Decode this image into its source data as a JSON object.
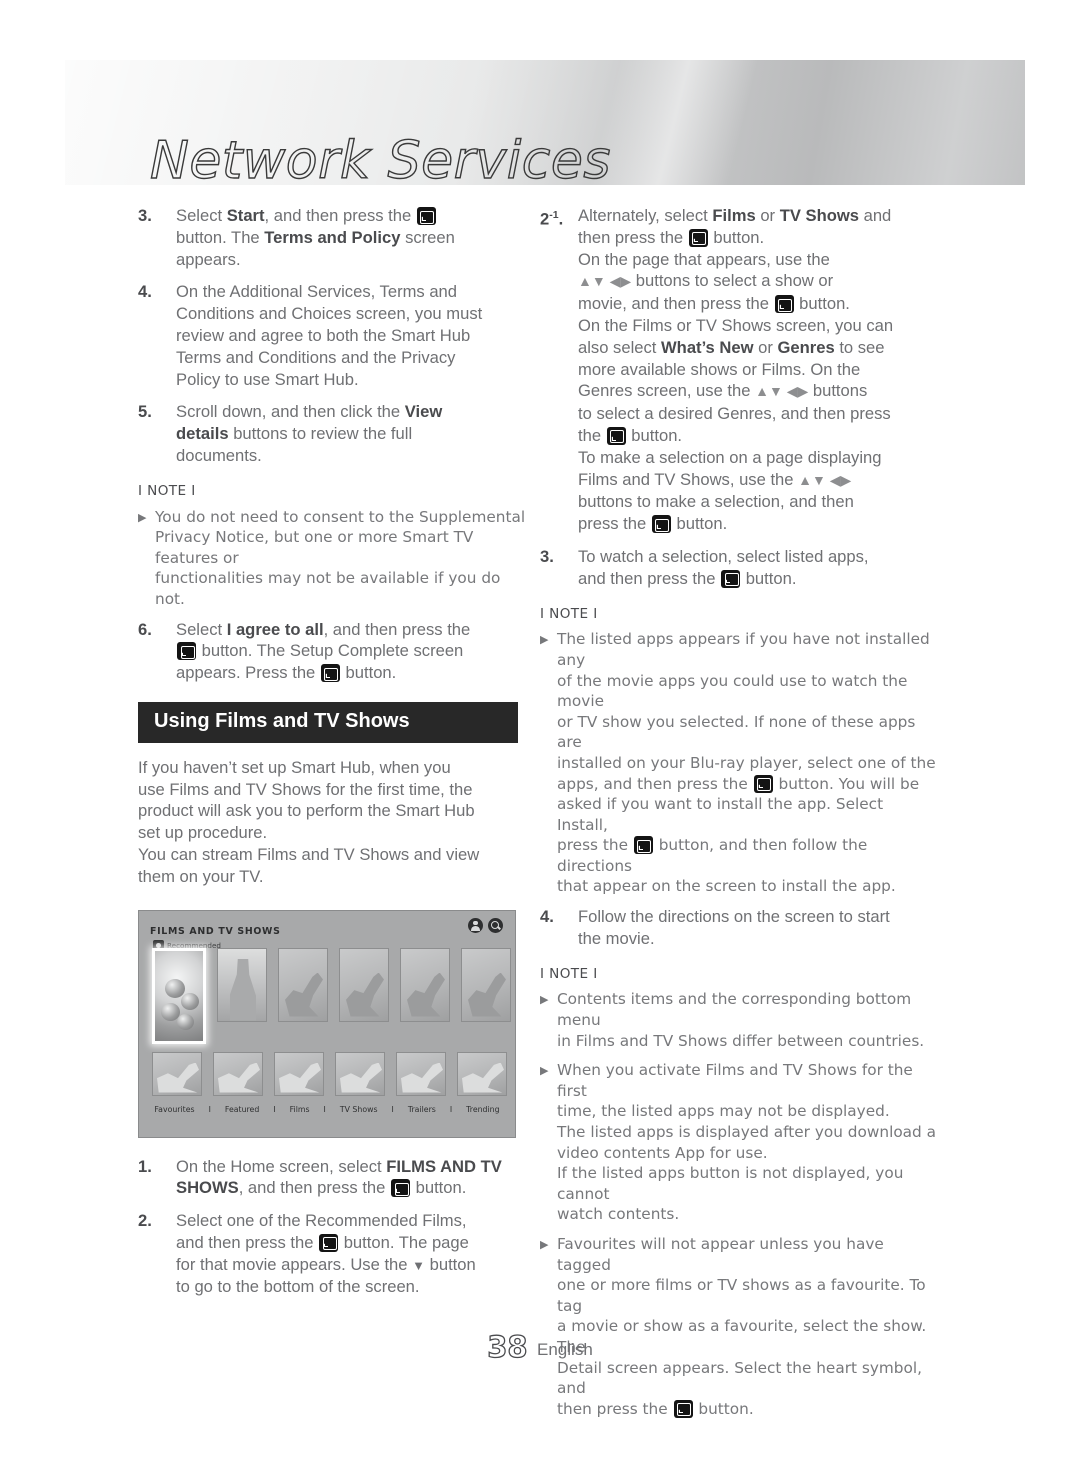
{
  "header": {
    "title": "Network Services"
  },
  "icons": {
    "enter_button": "enter-button-icon",
    "dpad_arrows": "▲▼ ◀▶",
    "down_arrow": "▼"
  },
  "left_column": {
    "steps": [
      {
        "num": "3.",
        "lines": [
          {
            "parts": [
              {
                "t": "Select "
              },
              {
                "t": "Start",
                "b": true
              },
              {
                "t": ", and then press the "
              },
              {
                "icon": "enter"
              }
            ]
          },
          {
            "parts": [
              {
                "t": "button. The "
              },
              {
                "t": "Terms and Policy",
                "b": true
              },
              {
                "t": " screen"
              }
            ]
          },
          {
            "parts": [
              {
                "t": "appears."
              }
            ]
          }
        ]
      },
      {
        "num": "4.",
        "lines": [
          {
            "parts": [
              {
                "t": "On the Additional Services, Terms and"
              }
            ]
          },
          {
            "parts": [
              {
                "t": "Conditions and Choices screen, you must"
              }
            ]
          },
          {
            "parts": [
              {
                "t": "review and agree to both the Smart Hub"
              }
            ]
          },
          {
            "parts": [
              {
                "t": "Terms and Conditions and the Privacy"
              }
            ]
          },
          {
            "parts": [
              {
                "t": "Policy to use Smart Hub."
              }
            ]
          }
        ]
      },
      {
        "num": "5.",
        "lines": [
          {
            "parts": [
              {
                "t": "Scroll down, and then click the "
              },
              {
                "t": "View",
                "b": true
              }
            ]
          },
          {
            "parts": [
              {
                "t": "details",
                "b": true
              },
              {
                "t": " buttons to review the full"
              }
            ]
          },
          {
            "parts": [
              {
                "t": "documents."
              }
            ]
          }
        ]
      }
    ],
    "note": {
      "head": "I NOTE I",
      "items": [
        {
          "lines": [
            {
              "parts": [
                {
                  "t": "You do not need to consent to the Supplemental"
                }
              ]
            },
            {
              "parts": [
                {
                  "t": "Privacy Notice, but one or more Smart TV features or"
                }
              ]
            },
            {
              "parts": [
                {
                  "t": "functionalities may not be available if you do not."
                }
              ]
            }
          ]
        }
      ]
    },
    "step6": {
      "num": "6.",
      "lines": [
        {
          "parts": [
            {
              "t": "Select "
            },
            {
              "t": "I agree to all",
              "b": true
            },
            {
              "t": ", and then press the"
            }
          ]
        },
        {
          "parts": [
            {
              "icon": "enter"
            },
            {
              "t": " button. The Setup Complete screen"
            }
          ]
        },
        {
          "parts": [
            {
              "t": "appears. Press the "
            },
            {
              "icon": "enter"
            },
            {
              "t": " button."
            }
          ]
        }
      ]
    },
    "section_title": "Using Films and TV Shows",
    "intro": [
      "If you haven’t set up Smart Hub, when you",
      "use Films and TV Shows for the first time, the",
      "product will ask you to perform the Smart Hub",
      "set up procedure.",
      "You can stream Films and TV Shows and view",
      "them on your TV."
    ],
    "tv_screenshot": {
      "title": "FILMS AND TV SHOWS",
      "account_icon": "person-icon",
      "search_icon": "search-icon",
      "recommended_label": "Recommended",
      "menu": [
        "Favourites",
        "Featured",
        "Films",
        "TV Shows",
        "Trailers",
        "Trending"
      ],
      "menu_separator": "I"
    },
    "steps_after": [
      {
        "num": "1.",
        "lines": [
          {
            "parts": [
              {
                "t": "On the Home screen, select "
              },
              {
                "t": "FILMS AND TV",
                "b": true
              }
            ]
          },
          {
            "parts": [
              {
                "t": "SHOWS",
                "b": true
              },
              {
                "t": ", and then press the "
              },
              {
                "icon": "enter"
              },
              {
                "t": " button."
              }
            ]
          }
        ]
      },
      {
        "num": "2.",
        "lines": [
          {
            "parts": [
              {
                "t": "Select one of the Recommended Films,"
              }
            ]
          },
          {
            "parts": [
              {
                "t": "and then press the "
              },
              {
                "icon": "enter"
              },
              {
                "t": " button. The page"
              }
            ]
          },
          {
            "parts": [
              {
                "t": "for that movie appears. Use the "
              },
              {
                "icon": "down"
              },
              {
                "t": " button"
              }
            ]
          },
          {
            "parts": [
              {
                "t": "to go to the bottom of the screen."
              }
            ]
          }
        ]
      }
    ]
  },
  "right_column": {
    "steps": [
      {
        "num": "2",
        "sup": "-1",
        "dot": ".",
        "lines": [
          {
            "parts": [
              {
                "t": "Alternately, select "
              },
              {
                "t": "Films",
                "b": true
              },
              {
                "t": " or "
              },
              {
                "t": "TV Shows",
                "b": true
              },
              {
                "t": " and"
              }
            ]
          },
          {
            "parts": [
              {
                "t": "then press the "
              },
              {
                "icon": "enter"
              },
              {
                "t": " button."
              }
            ]
          },
          {
            "parts": [
              {
                "t": "On the page that appears, use the"
              }
            ]
          },
          {
            "parts": [
              {
                "icon": "dpad"
              },
              {
                "t": " buttons to select a show or"
              }
            ]
          },
          {
            "parts": [
              {
                "t": "movie, and then press the "
              },
              {
                "icon": "enter"
              },
              {
                "t": " button."
              }
            ]
          },
          {
            "parts": [
              {
                "t": "On the Films or TV Shows screen, you can"
              }
            ]
          },
          {
            "parts": [
              {
                "t": "also select "
              },
              {
                "t": "What’s New",
                "b": true
              },
              {
                "t": " or "
              },
              {
                "t": "Genres",
                "b": true
              },
              {
                "t": " to see"
              }
            ]
          },
          {
            "parts": [
              {
                "t": "more available shows or Films. On the"
              }
            ]
          },
          {
            "parts": [
              {
                "t": "Genres screen, use the "
              },
              {
                "icon": "dpad"
              },
              {
                "t": " buttons"
              }
            ]
          },
          {
            "parts": [
              {
                "t": "to select a desired Genres, and then press"
              }
            ]
          },
          {
            "parts": [
              {
                "t": "the "
              },
              {
                "icon": "enter"
              },
              {
                "t": " button."
              }
            ]
          },
          {
            "parts": [
              {
                "t": "To make a selection on a page displaying"
              }
            ]
          },
          {
            "parts": [
              {
                "t": "Films and TV Shows, use the "
              },
              {
                "icon": "dpad"
              }
            ]
          },
          {
            "parts": [
              {
                "t": "buttons to make a selection, and then"
              }
            ]
          },
          {
            "parts": [
              {
                "t": "press the "
              },
              {
                "icon": "enter"
              },
              {
                "t": " button."
              }
            ]
          }
        ]
      },
      {
        "num": "3.",
        "lines": [
          {
            "parts": [
              {
                "t": "To watch a selection, select listed apps,"
              }
            ]
          },
          {
            "parts": [
              {
                "t": "and then press the "
              },
              {
                "icon": "enter"
              },
              {
                "t": " button."
              }
            ]
          }
        ]
      }
    ],
    "note1": {
      "head": "I NOTE I",
      "items": [
        {
          "lines": [
            {
              "parts": [
                {
                  "t": "The listed apps appears if you have not installed any"
                }
              ]
            },
            {
              "parts": [
                {
                  "t": "of the movie apps you could use to watch the movie"
                }
              ]
            },
            {
              "parts": [
                {
                  "t": "or TV show you selected. If none of these apps are"
                }
              ]
            },
            {
              "parts": [
                {
                  "t": "installed on your Blu-ray player, select one of the"
                }
              ]
            },
            {
              "parts": [
                {
                  "t": "apps, and then press the "
                },
                {
                  "icon": "enter"
                },
                {
                  "t": " button. You will be"
                }
              ]
            },
            {
              "parts": [
                {
                  "t": "asked if you want to install the app. Select Install,"
                }
              ]
            },
            {
              "parts": [
                {
                  "t": "press the "
                },
                {
                  "icon": "enter"
                },
                {
                  "t": " button, and then follow the directions"
                }
              ]
            },
            {
              "parts": [
                {
                  "t": "that appear on the screen to install the app."
                }
              ]
            }
          ]
        }
      ]
    },
    "step4": {
      "num": "4.",
      "lines": [
        {
          "parts": [
            {
              "t": "Follow the directions on the screen to start"
            }
          ]
        },
        {
          "parts": [
            {
              "t": "the movie."
            }
          ]
        }
      ]
    },
    "note2": {
      "head": "I NOTE I",
      "items": [
        {
          "lines": [
            {
              "parts": [
                {
                  "t": "Contents items and the corresponding bottom menu"
                }
              ]
            },
            {
              "parts": [
                {
                  "t": "in Films and TV Shows differ between countries."
                }
              ]
            }
          ]
        },
        {
          "lines": [
            {
              "parts": [
                {
                  "t": "When you activate Films and TV Shows for the first"
                }
              ]
            },
            {
              "parts": [
                {
                  "t": "time, the listed apps may not be displayed."
                }
              ]
            },
            {
              "parts": [
                {
                  "t": "The listed apps is displayed after you download a"
                }
              ]
            },
            {
              "parts": [
                {
                  "t": "video contents App for use."
                }
              ]
            },
            {
              "parts": [
                {
                  "t": "If the listed apps button is not displayed, you cannot"
                }
              ]
            },
            {
              "parts": [
                {
                  "t": "watch contents."
                }
              ]
            }
          ]
        },
        {
          "lines": [
            {
              "parts": [
                {
                  "t": "Favourites will not appear unless you have tagged"
                }
              ]
            },
            {
              "parts": [
                {
                  "t": "one or more  films or TV shows as a favourite. To tag"
                }
              ]
            },
            {
              "parts": [
                {
                  "t": "a movie or show as a favourite, select the show. The"
                }
              ]
            },
            {
              "parts": [
                {
                  "t": "Detail screen appears. Select the heart symbol, and"
                }
              ]
            },
            {
              "parts": [
                {
                  "t": "then press the "
                },
                {
                  "icon": "enter"
                },
                {
                  "t": " button."
                }
              ]
            }
          ]
        }
      ]
    }
  },
  "footer": {
    "page_number": "38",
    "language": "English"
  }
}
